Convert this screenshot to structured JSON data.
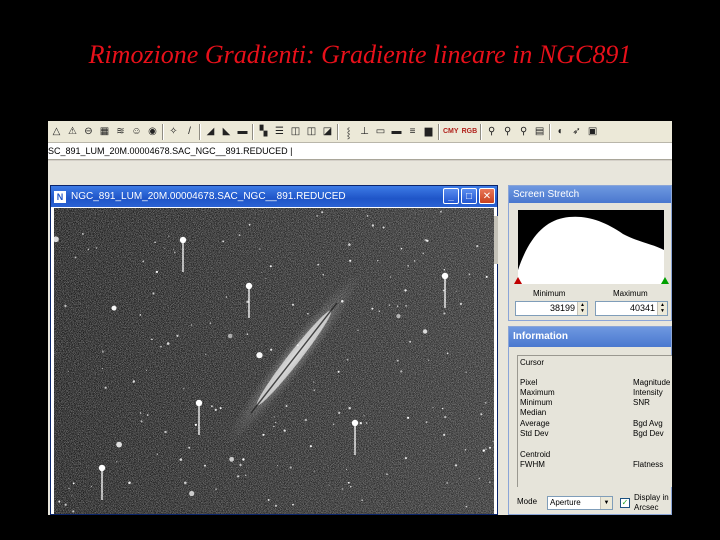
{
  "slide": {
    "title": "Rimozione Gradienti: Gradiente lineare in NGC891"
  },
  "toolbar": {
    "icons": [
      "warning-icon",
      "triangle-icon",
      "link-icon",
      "grid-icon",
      "layers-icon",
      "smiley-icon",
      "globe-icon",
      "star-icon",
      "pencil-icon",
      "mountain-icon",
      "mountain-icon",
      "ruler-icon",
      "color-icon",
      "list-icon",
      "window-icon",
      "window-icon",
      "window-icon",
      "text-icon",
      "align-icon",
      "align-icon",
      "bar-icon",
      "bar-icon",
      "bar-icon",
      "camera-icon",
      "zoom-in-icon",
      "zoom-out-icon",
      "zoom-fit-icon",
      "table-icon",
      "compare-icon",
      "arrow-icon",
      "image-icon"
    ],
    "text_buttons": [
      "CMY",
      "RGB"
    ]
  },
  "filebar": {
    "text": "SC_891_LUM_20M.00004678.SAC_NGC__891.REDUCED"
  },
  "image_window": {
    "title": "NGC_891_LUM_20M.00004678.SAC_NGC__891.REDUCED",
    "min_glyph": "_",
    "max_glyph": "□",
    "close_glyph": "✕"
  },
  "screen_stretch": {
    "title": "Screen Stretch",
    "minimum_label": "Minimum",
    "maximum_label": "Maximum",
    "minimum_value": "38199",
    "maximum_value": "40341"
  },
  "information": {
    "title": "Information",
    "cursor_label": "Cursor",
    "left_labels": [
      "Pixel",
      "Maximum",
      "Minimum",
      "Median",
      "Average",
      "Std Dev"
    ],
    "right_labels": [
      "Magnitude",
      "Intensity",
      "SNR",
      "",
      "Bgd Avg",
      "Bgd Dev"
    ],
    "centroid_label": "Centroid",
    "fwhm_label": "FWHM",
    "flatness_label": "Flatness",
    "mode_label": "Mode",
    "mode_value": "Aperture",
    "display_label_line1": "Display in",
    "display_label_line2": "Arcsec",
    "display_checked": true
  },
  "colors": {
    "title_red": "#e8101a",
    "xp_blue": "#1f55c8",
    "panel_header": "#4a78cf"
  }
}
